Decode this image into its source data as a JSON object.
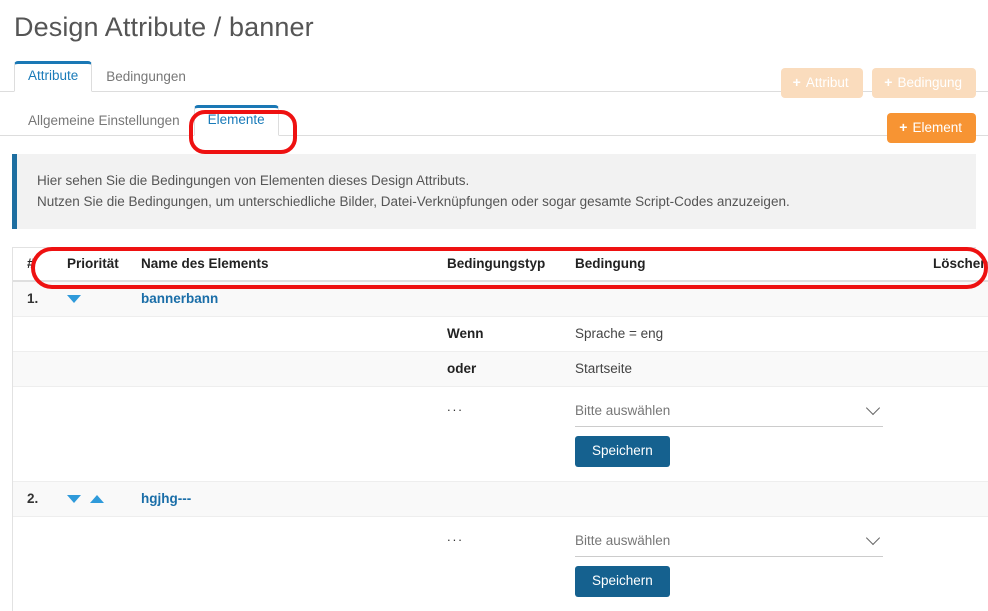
{
  "page": {
    "title": "Design Attribute / banner"
  },
  "tabs_primary": [
    {
      "label": "Attribute",
      "active": true
    },
    {
      "label": "Bedingungen",
      "active": false
    }
  ],
  "tabs_secondary": [
    {
      "label": "Allgemeine Einstellungen",
      "active": false
    },
    {
      "label": "Elemente",
      "active": true
    }
  ],
  "header_actions": {
    "attribut": "Attribut",
    "bedingung": "Bedingung",
    "element": "Element",
    "plus": "+"
  },
  "info": {
    "line1": "Hier sehen Sie die Bedingungen von Elementen dieses Design Attributs.",
    "line2": "Nutzen Sie die Bedingungen, um unterschiedliche Bilder, Datei-Verknüpfungen oder sogar gesamte Script-Codes anzuzeigen."
  },
  "table": {
    "headers": {
      "num": "#",
      "priority": "Priorität",
      "name": "Name des Elements",
      "condition_type": "Bedingungstyp",
      "condition": "Bedingung",
      "delete": "Löschen"
    },
    "rows": [
      {
        "kind": "element",
        "num": "1.",
        "name": "bannerbann",
        "arrows": [
          "down"
        ],
        "delete": "✖"
      },
      {
        "kind": "condition",
        "condition_type": "Wenn",
        "condition": "Sprache = eng",
        "delete": "✖"
      },
      {
        "kind": "condition",
        "condition_type": "oder",
        "condition": "Startseite",
        "delete": "✖"
      },
      {
        "kind": "new-condition",
        "condition_type": "...",
        "select_value": "Bitte auswählen",
        "save_label": "Speichern"
      },
      {
        "kind": "element",
        "num": "2.",
        "name": "hgjhg---",
        "arrows": [
          "down",
          "up"
        ],
        "delete": "✖"
      },
      {
        "kind": "new-condition",
        "condition_type": "...",
        "select_value": "Bitte auswählen",
        "save_label": "Speichern"
      }
    ]
  },
  "annotations": {
    "elemente_highlight": "Elemente tab highlighted",
    "header_highlight": "table header row highlighted",
    "color": "#ee1111"
  },
  "colors": {
    "accent_blue": "#1a78b5",
    "orange": "#f79433",
    "orange_faded": "#fadcbd",
    "save_blue": "#15618f",
    "delete_red": "#b01628",
    "arrow_blue": "#2f9ada"
  }
}
